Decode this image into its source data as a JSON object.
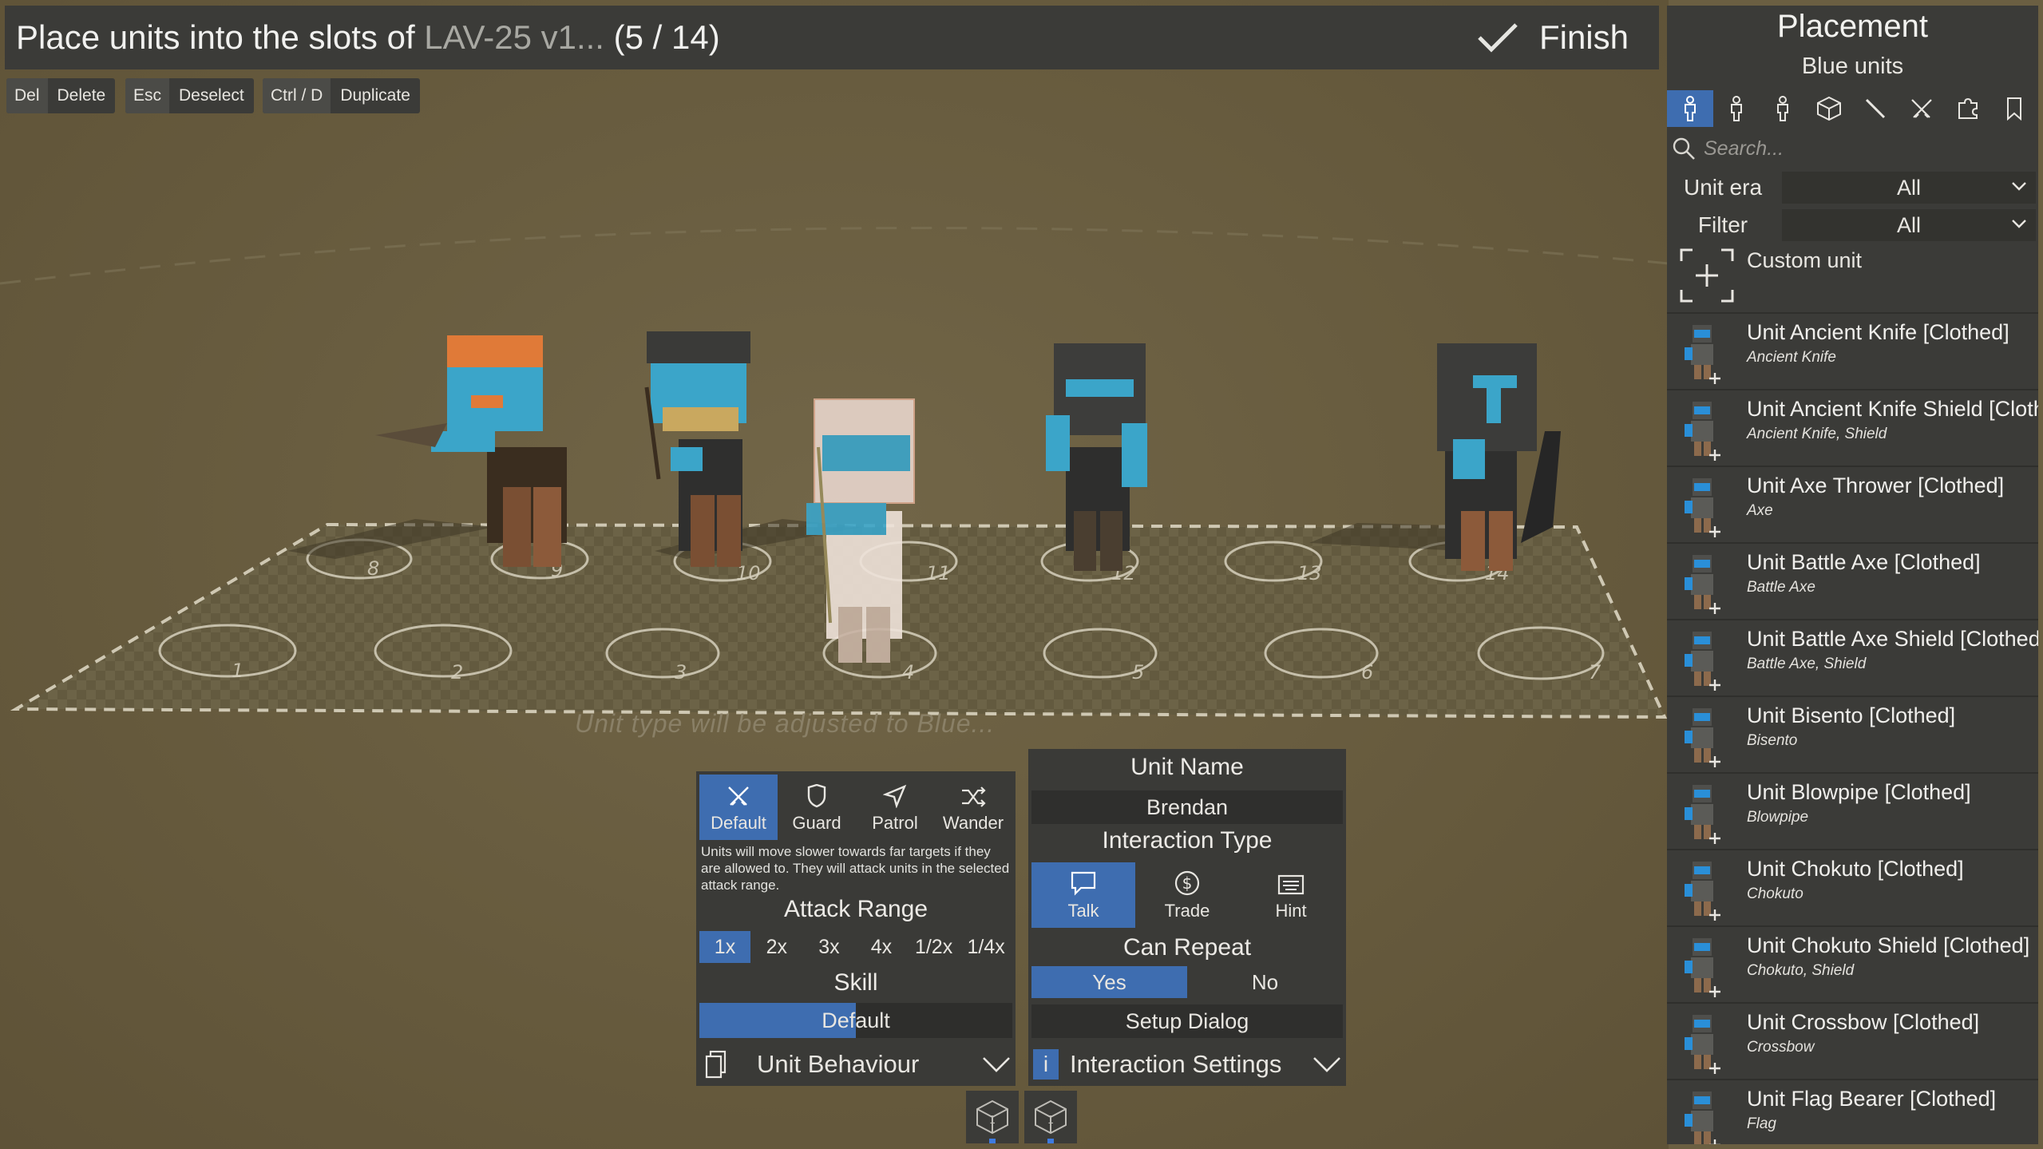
{
  "header": {
    "title_prefix": "Place units into the slots of ",
    "vehicle": "LAV-25 v1...",
    "count": " (5 / 14)",
    "finish_label": "Finish"
  },
  "shortcuts": [
    {
      "key": "Del",
      "action": "Delete"
    },
    {
      "key": "Esc",
      "action": "Deselect"
    },
    {
      "key": "Ctrl / D",
      "action": "Duplicate"
    }
  ],
  "scene": {
    "hint": "Unit type will be adjusted to Blue...",
    "slots": [
      "1",
      "2",
      "3",
      "4",
      "5",
      "6",
      "7",
      "8",
      "9",
      "10",
      "11",
      "12",
      "13",
      "14"
    ]
  },
  "behaviour": {
    "modes": [
      {
        "label": "Default",
        "icon": "swords-icon"
      },
      {
        "label": "Guard",
        "icon": "shield-icon"
      },
      {
        "label": "Patrol",
        "icon": "navigate-icon"
      },
      {
        "label": "Wander",
        "icon": "shuffle-icon"
      }
    ],
    "description": "Units will move slower towards far targets if they are allowed to. They will attack units in the selected attack range.",
    "attack_range_title": "Attack Range",
    "ranges": [
      "1x",
      "2x",
      "3x",
      "4x",
      "1/2x",
      "1/4x"
    ],
    "selected_range": "1x",
    "skill_title": "Skill",
    "skill_value": "Default",
    "skill_level": 0.5,
    "dropdown_label": "Unit Behaviour"
  },
  "interaction": {
    "unit_name_title": "Unit Name",
    "unit_name": "Brendan",
    "type_title": "Interaction Type",
    "types": [
      {
        "label": "Talk",
        "icon": "speech-bubble-icon"
      },
      {
        "label": "Trade",
        "icon": "dollar-icon"
      },
      {
        "label": "Hint",
        "icon": "keyboard-icon"
      }
    ],
    "can_repeat_title": "Can Repeat",
    "yes": "Yes",
    "no": "No",
    "setup_label": "Setup Dialog",
    "dropdown_label": "Interaction Settings",
    "info_glyph": "i"
  },
  "mini": [
    "1",
    "1"
  ],
  "sidebar": {
    "title": "Placement",
    "subtitle": "Blue units",
    "search_placeholder": "Search...",
    "unit_era_label": "Unit era",
    "unit_era_value": "All",
    "filter_label": "Filter",
    "filter_value": "All",
    "custom_unit": "Custom unit",
    "units": [
      {
        "name": "Unit Ancient Knife [Clothed]",
        "sub": "Ancient Knife",
        "color": "#2a8fd8"
      },
      {
        "name": "Unit Ancient Knife Shield [Clothed]",
        "sub": "Ancient Knife, Shield",
        "color": "#2a8fd8"
      },
      {
        "name": "Unit Axe Thrower [Clothed]",
        "sub": "Axe",
        "color": "#2a8fd8"
      },
      {
        "name": "Unit Battle Axe [Clothed]",
        "sub": "Battle Axe",
        "color": "#2a8fd8"
      },
      {
        "name": "Unit Battle Axe Shield [Clothed]",
        "sub": "Battle Axe, Shield",
        "color": "#2a8fd8"
      },
      {
        "name": "Unit Bisento [Clothed]",
        "sub": "Bisento",
        "color": "#2a8fd8"
      },
      {
        "name": "Unit Blowpipe [Clothed]",
        "sub": "Blowpipe",
        "color": "#2a8fd8"
      },
      {
        "name": "Unit Chokuto [Clothed]",
        "sub": "Chokuto",
        "color": "#2a8fd8"
      },
      {
        "name": "Unit Chokuto Shield [Clothed]",
        "sub": "Chokuto, Shield",
        "color": "#2a8fd8"
      },
      {
        "name": "Unit Crossbow [Clothed]",
        "sub": "Crossbow",
        "color": "#2a8fd8"
      },
      {
        "name": "Unit Flag Bearer [Clothed]",
        "sub": "Flag",
        "color": "#2a8fd8"
      }
    ]
  },
  "colors": {
    "accent": "#3e6db0",
    "panel": "#3a3a37",
    "ground": "#6b5f42",
    "unit_blue": "#3ba5c9",
    "unit_orange": "#e07a38"
  }
}
